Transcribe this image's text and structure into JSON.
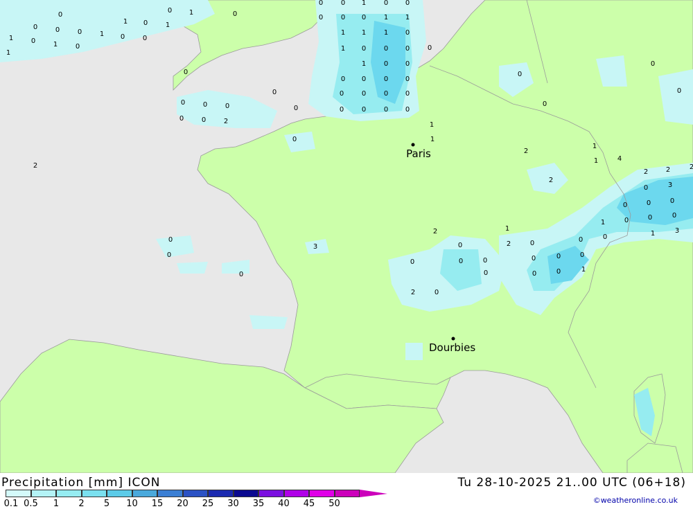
{
  "footer": {
    "title": "Precipitation [mm] ICON",
    "timestamp": "Tu 28-10-2025 21..00 UTC (06+18)",
    "credit": "©weatheronline.co.uk"
  },
  "legend": {
    "values": [
      "0.1",
      "0.5",
      "1",
      "2",
      "5",
      "10",
      "15",
      "20",
      "25",
      "30",
      "35",
      "40",
      "45",
      "50"
    ],
    "colors": [
      "#d4fafa",
      "#b4f3f6",
      "#96edf2",
      "#7ae0ef",
      "#5ccbe8",
      "#4aa9dc",
      "#3b7fd4",
      "#2b52c4",
      "#1b2ab0",
      "#0b0a90",
      "#7b10e0",
      "#b000e8",
      "#e000e8",
      "#cc00bb"
    ]
  },
  "map": {
    "colors": {
      "sea": "#e8e8e8",
      "land": "#ccffaa",
      "rain_light": "#c8f6f6",
      "rain_mid": "#96ecf0",
      "rain_heavy": "#6cd8ee"
    },
    "cities": [
      {
        "name": "Paris",
        "marker": "dot"
      },
      {
        "name": "Dourbies",
        "marker": "dot"
      }
    ],
    "values": [
      "0",
      "0",
      "1",
      "0",
      "0",
      "0",
      "1",
      "0",
      "0",
      "0",
      "0",
      "0",
      "1",
      "1",
      "1",
      "0",
      "1",
      "0",
      "0",
      "0",
      "1",
      "0",
      "0",
      "1",
      "1",
      "1",
      "0",
      "1",
      "0",
      "1",
      "0",
      "1",
      "1",
      "0",
      "0",
      "0",
      "0",
      "1",
      "0",
      "0",
      "0",
      "0",
      "0",
      "0",
      "0",
      "0",
      "0",
      "0",
      "0",
      "0",
      "0",
      "0",
      "0",
      "0",
      "0",
      "0",
      "0",
      "0",
      "0",
      "0",
      "0",
      "0",
      "0",
      "0",
      "2",
      "1",
      "1",
      "0",
      "1",
      "1",
      "4",
      "2",
      "2",
      "2",
      "2",
      "2",
      "2",
      "0",
      "3",
      "0",
      "0",
      "0",
      "1",
      "0",
      "0",
      "0",
      "1",
      "3",
      "2",
      "1",
      "3",
      "0",
      "2",
      "0",
      "0",
      "0",
      "0",
      "0",
      "0",
      "0",
      "0",
      "0",
      "0",
      "0",
      "0",
      "0",
      "0",
      "0",
      "1",
      "2",
      "0"
    ]
  }
}
